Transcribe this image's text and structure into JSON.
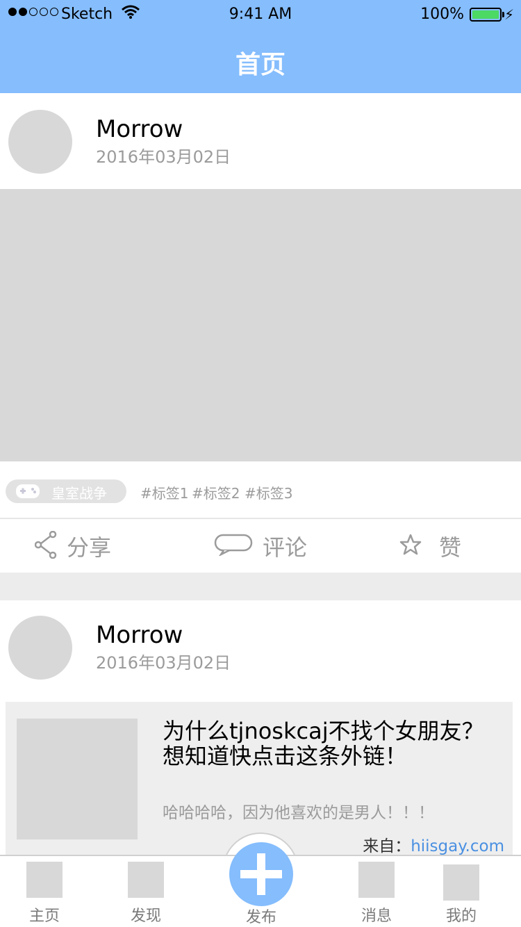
{
  "status_bar": {
    "carrier": "Sketch",
    "time": "9:41 AM",
    "battery": "100%"
  },
  "nav": {
    "title": "首页"
  },
  "posts": [
    {
      "username": "Morrow",
      "date": "2016年03月02日",
      "game_tag": "皇室战争",
      "tags": [
        "#标签1",
        "#标签2",
        "#标签3"
      ],
      "actions": {
        "share": "分享",
        "comment": "评论",
        "like": "赞"
      }
    },
    {
      "username": "Morrow",
      "date": "2016年03月02日",
      "link": {
        "title": "为什么tjnoskcaj不找个女朋友？想知道快点击这条外链！",
        "description": "哈哈哈哈，因为他喜欢的是男人！！！",
        "source_prefix": "来自：",
        "source_domain": "hiisgay.com"
      }
    }
  ],
  "tabbar": {
    "home": "主页",
    "discover": "发现",
    "publish": "发布",
    "messages": "消息",
    "mine": "我的"
  },
  "colors": {
    "accent": "#85bdfd",
    "link": "#4a90e2",
    "placeholder": "#d8d8d8"
  }
}
